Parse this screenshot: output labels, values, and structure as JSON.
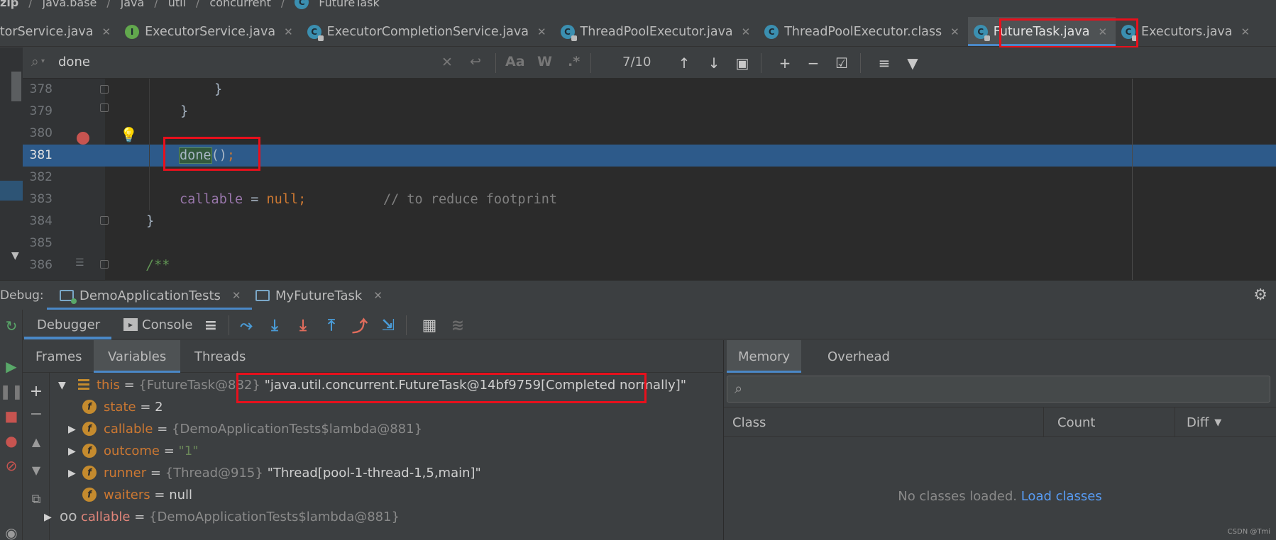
{
  "breadcrumb": [
    "zip",
    "java.base",
    "java",
    "util",
    "concurrent",
    "FutureTask"
  ],
  "tabs": [
    {
      "label": "AbstractExecutorService.java",
      "icon": "class-icon"
    },
    {
      "label": "ExecutorService.java",
      "icon": "interface-icon"
    },
    {
      "label": "ExecutorCompletionService.java",
      "icon": "class-icon"
    },
    {
      "label": "ThreadPoolExecutor.java",
      "icon": "class-icon"
    },
    {
      "label": "ThreadPoolExecutor.class",
      "icon": "class-icon"
    },
    {
      "label": "FutureTask.java",
      "icon": "class-icon",
      "active": true
    },
    {
      "label": "Executors.java",
      "icon": "class-icon"
    }
  ],
  "find": {
    "query": "done",
    "match_count": "7/10",
    "aa": "Aa",
    "w": "W",
    "regex": ".*"
  },
  "editor": {
    "lines": [
      {
        "no": "378",
        "text": "}"
      },
      {
        "no": "379",
        "text": "}"
      },
      {
        "no": "380",
        "text": ""
      },
      {
        "no": "381",
        "text": "done();"
      },
      {
        "no": "382",
        "text": ""
      },
      {
        "no": "383",
        "code": "callable = null;",
        "comment": "// to reduce footprint"
      },
      {
        "no": "384",
        "text": "}"
      },
      {
        "no": "385",
        "text": ""
      },
      {
        "no": "386",
        "text": "/**"
      }
    ]
  },
  "debug": {
    "label": "Debug:",
    "sessions": [
      "DemoApplicationTests",
      "MyFutureTask"
    ],
    "tabs": {
      "debugger": "Debugger",
      "console": "Console"
    },
    "panel_tabs": {
      "frames": "Frames",
      "variables": "Variables",
      "threads": "Threads"
    }
  },
  "variables": [
    {
      "name": "this",
      "eq": " = ",
      "type": "{FutureTask@882}",
      "value": "\"java.util.concurrent.FutureTask@14bf9759[Completed normally]\""
    },
    {
      "name": "state",
      "eq": " = ",
      "value": "2"
    },
    {
      "name": "callable",
      "eq": " = ",
      "type": "{DemoApplicationTests$lambda@881}"
    },
    {
      "name": "outcome",
      "eq": " = ",
      "value": "\"1\""
    },
    {
      "name": "runner",
      "eq": " = ",
      "type": "{Thread@915}",
      "value": "\"Thread[pool-1-thread-1,5,main]\""
    },
    {
      "name": "waiters",
      "eq": " = ",
      "value": "null"
    },
    {
      "name": "callable",
      "eq": " = ",
      "type": "{DemoApplicationTests$lambda@881}"
    }
  ],
  "memory": {
    "tabs": [
      "Memory",
      "Overhead"
    ],
    "columns": [
      "Class",
      "Count",
      "Diff"
    ],
    "empty_text": "No classes loaded.",
    "load_link": "Load classes"
  },
  "watermark": "CSDN @Tmi",
  "colors": {
    "accent": "#4a88c7",
    "highlight_line": "#2d5a8a",
    "annotation": "#e8101c"
  }
}
